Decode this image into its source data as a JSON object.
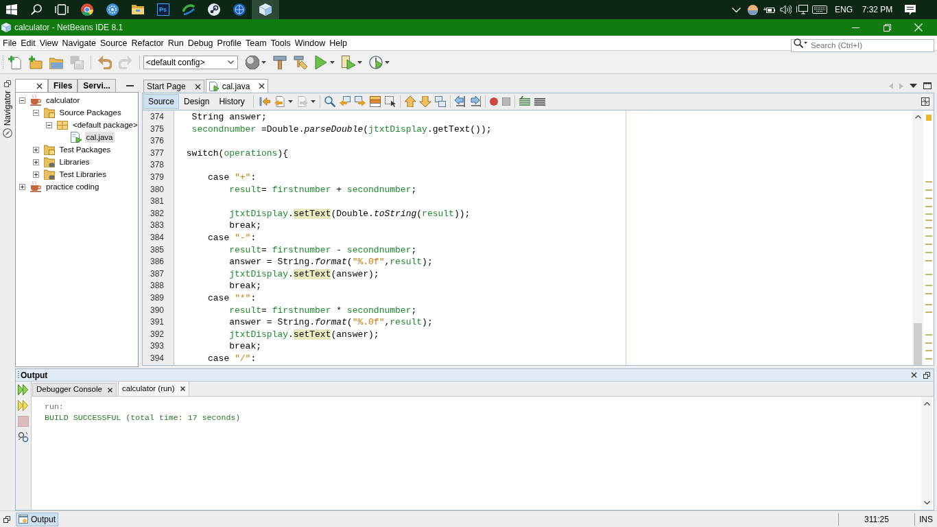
{
  "taskbar": {
    "apps": [
      {
        "selected": false
      },
      {
        "selected": false
      },
      {
        "selected": false
      },
      {
        "selected": false,
        "label": "Ps"
      },
      {
        "selected": false
      },
      {
        "selected": false
      },
      {
        "selected": false
      },
      {
        "selected": true
      }
    ],
    "tray": {
      "language": "ENG",
      "time": "7:32 PM"
    }
  },
  "window": {
    "title": "calculator - NetBeans IDE 8.1"
  },
  "menu": [
    "File",
    "Edit",
    "View",
    "Navigate",
    "Source",
    "Refactor",
    "Run",
    "Debug",
    "Profile",
    "Team",
    "Tools",
    "Window",
    "Help"
  ],
  "search": {
    "placeholder": "Search (Ctrl+I)"
  },
  "toolbar": {
    "file_buttons": [
      {
        "disabled": false
      },
      {
        "disabled": false
      },
      {
        "disabled": false
      },
      {
        "disabled": true
      }
    ],
    "edit_buttons": [
      {
        "disabled": false
      },
      {
        "disabled": true
      }
    ],
    "config": "<default config>",
    "run_buttons": [
      {
        "dropdown": true
      },
      {
        "dropdown": false
      },
      {
        "dropdown": false
      },
      {
        "dropdown": true
      },
      {
        "dropdown": true
      },
      {
        "dropdown": true
      }
    ]
  },
  "side_strip": {
    "label": "Navigator"
  },
  "projects": {
    "tabs": [
      {
        "selected": true,
        "closable": true
      },
      {
        "label": "Files",
        "selected": false,
        "closable": false
      },
      {
        "label": "Servi...",
        "selected": false,
        "closable": false
      }
    ],
    "tree": [
      {
        "label": "calculator",
        "kind": "project",
        "expanded": true,
        "selected": false,
        "children": [
          {
            "label": "Source Packages",
            "kind": "source_folder",
            "expanded": true,
            "selected": false,
            "children": [
              {
                "label": "<default package>",
                "kind": "package",
                "expanded": true,
                "selected": false,
                "children": [
                  {
                    "label": "cal.java",
                    "kind": "java_file",
                    "selected": true
                  }
                ]
              }
            ]
          },
          {
            "label": "Test Packages",
            "kind": "source_folder",
            "expanded": false,
            "selected": false
          },
          {
            "label": "Libraries",
            "kind": "library_folder",
            "expanded": false,
            "selected": false
          },
          {
            "label": "Test Libraries",
            "kind": "library_folder",
            "expanded": false,
            "selected": false
          }
        ]
      },
      {
        "label": "practice coding",
        "kind": "project",
        "expanded": false,
        "selected": false
      }
    ]
  },
  "editor": {
    "tabs": [
      {
        "label": "Start Page",
        "selected": false
      },
      {
        "label": "cal.java",
        "selected": true
      }
    ],
    "views": [
      {
        "label": "Source",
        "selected": true
      },
      {
        "label": "Design",
        "selected": false
      },
      {
        "label": "History",
        "selected": false
      }
    ],
    "toolbar": [
      {
        "disabled": false,
        "dropdown": false
      },
      {
        "disabled": false,
        "dropdown": true
      },
      {
        "disabled": true,
        "dropdown": true
      },
      {
        "disabled": false,
        "dropdown": false
      },
      {
        "disabled": false,
        "dropdown": false
      },
      {
        "disabled": false,
        "dropdown": false
      },
      {
        "disabled": false,
        "dropdown": false
      },
      {
        "disabled": false,
        "dropdown": false
      },
      {
        "disabled": false,
        "dropdown": false
      },
      {
        "disabled": false,
        "dropdown": false
      },
      {
        "disabled": false,
        "dropdown": false
      },
      {
        "disabled": false,
        "dropdown": false
      },
      {
        "disabled": false,
        "dropdown": false
      },
      {
        "disabled": false,
        "dropdown": false
      },
      {
        "disabled": false,
        "dropdown": false
      },
      {
        "disabled": false,
        "dropdown": false
      },
      {
        "disabled": false,
        "dropdown": false
      }
    ],
    "lines": [
      {
        "number": "374",
        "tokens": [
          {
            "text": "  String answer;",
            "kind": "plain"
          }
        ]
      },
      {
        "number": "375",
        "tokens": [
          {
            "text": "  secondnumber",
            "kind": "field"
          },
          {
            "text": " =Double.",
            "kind": "plain"
          },
          {
            "text": "parseDouble",
            "kind": "method"
          },
          {
            "text": "(",
            "kind": "plain"
          },
          {
            "text": "jtxtDisplay",
            "kind": "field"
          },
          {
            "text": ".getText());",
            "kind": "plain"
          }
        ]
      },
      {
        "number": "376"
      },
      {
        "number": "377",
        "tokens": [
          {
            "text": " switch(",
            "kind": "plain"
          },
          {
            "text": "operations",
            "kind": "field"
          },
          {
            "text": "){",
            "kind": "plain"
          }
        ]
      },
      {
        "number": "378"
      },
      {
        "number": "379",
        "tokens": [
          {
            "text": "     case ",
            "kind": "plain"
          },
          {
            "text": "\"+\"",
            "kind": "string"
          },
          {
            "text": ":",
            "kind": "plain"
          }
        ]
      },
      {
        "number": "380",
        "tokens": [
          {
            "text": "         result",
            "kind": "field"
          },
          {
            "text": "= ",
            "kind": "plain"
          },
          {
            "text": "firstnumber",
            "kind": "field"
          },
          {
            "text": " + ",
            "kind": "plain"
          },
          {
            "text": "secondnumber",
            "kind": "field"
          },
          {
            "text": ";",
            "kind": "plain"
          }
        ]
      },
      {
        "number": "381"
      },
      {
        "number": "382",
        "tokens": [
          {
            "text": "         jtxtDisplay",
            "kind": "field"
          },
          {
            "text": ".",
            "kind": "plain"
          },
          {
            "text": "setText",
            "kind": "occurrence"
          },
          {
            "text": "(Double.",
            "kind": "plain"
          },
          {
            "text": "toString",
            "kind": "method"
          },
          {
            "text": "(",
            "kind": "plain"
          },
          {
            "text": "result",
            "kind": "field"
          },
          {
            "text": "));",
            "kind": "plain"
          }
        ]
      },
      {
        "number": "383",
        "tokens": [
          {
            "text": "         break;",
            "kind": "plain"
          }
        ]
      },
      {
        "number": "384",
        "tokens": [
          {
            "text": "     case ",
            "kind": "plain"
          },
          {
            "text": "\"-\"",
            "kind": "string"
          },
          {
            "text": ":",
            "kind": "plain"
          }
        ]
      },
      {
        "number": "385",
        "tokens": [
          {
            "text": "         result",
            "kind": "field"
          },
          {
            "text": "= ",
            "kind": "plain"
          },
          {
            "text": "firstnumber",
            "kind": "field"
          },
          {
            "text": " - ",
            "kind": "plain"
          },
          {
            "text": "secondnumber",
            "kind": "field"
          },
          {
            "text": ";",
            "kind": "plain"
          }
        ]
      },
      {
        "number": "386",
        "tokens": [
          {
            "text": "         answer = String.",
            "kind": "plain"
          },
          {
            "text": "format",
            "kind": "method"
          },
          {
            "text": "(",
            "kind": "plain"
          },
          {
            "text": "\"%.0f\"",
            "kind": "string"
          },
          {
            "text": ",",
            "kind": "plain"
          },
          {
            "text": "result",
            "kind": "field"
          },
          {
            "text": ");",
            "kind": "plain"
          }
        ]
      },
      {
        "number": "387",
        "tokens": [
          {
            "text": "         jtxtDisplay",
            "kind": "field"
          },
          {
            "text": ".",
            "kind": "plain"
          },
          {
            "text": "setText",
            "kind": "occurrence"
          },
          {
            "text": "(answer);",
            "kind": "plain"
          }
        ]
      },
      {
        "number": "388",
        "tokens": [
          {
            "text": "         break;",
            "kind": "plain"
          }
        ]
      },
      {
        "number": "389",
        "tokens": [
          {
            "text": "     case ",
            "kind": "plain"
          },
          {
            "text": "\"*\"",
            "kind": "string"
          },
          {
            "text": ":",
            "kind": "plain"
          }
        ]
      },
      {
        "number": "390",
        "tokens": [
          {
            "text": "         result",
            "kind": "field"
          },
          {
            "text": "= ",
            "kind": "plain"
          },
          {
            "text": "firstnumber",
            "kind": "field"
          },
          {
            "text": " * ",
            "kind": "plain"
          },
          {
            "text": "secondnumber",
            "kind": "field"
          },
          {
            "text": ";",
            "kind": "plain"
          }
        ]
      },
      {
        "number": "391",
        "tokens": [
          {
            "text": "         answer = String.",
            "kind": "plain"
          },
          {
            "text": "format",
            "kind": "method"
          },
          {
            "text": "(",
            "kind": "plain"
          },
          {
            "text": "\"%.0f\"",
            "kind": "string"
          },
          {
            "text": ",",
            "kind": "plain"
          },
          {
            "text": "result",
            "kind": "field"
          },
          {
            "text": ");",
            "kind": "plain"
          }
        ]
      },
      {
        "number": "392",
        "tokens": [
          {
            "text": "         jtxtDisplay",
            "kind": "field"
          },
          {
            "text": ".",
            "kind": "plain"
          },
          {
            "text": "setText",
            "kind": "occurrence"
          },
          {
            "text": "(answer);",
            "kind": "plain"
          }
        ]
      },
      {
        "number": "393",
        "tokens": [
          {
            "text": "         break;",
            "kind": "plain"
          }
        ]
      },
      {
        "number": "394",
        "tokens": [
          {
            "text": "     case ",
            "kind": "plain"
          },
          {
            "text": "\"/\"",
            "kind": "string"
          },
          {
            "text": ":",
            "kind": "plain"
          }
        ]
      }
    ]
  },
  "output": {
    "title": "Output",
    "actions": [
      {
        "disabled": false
      },
      {
        "disabled": false
      },
      {
        "disabled": true
      },
      {
        "disabled": false
      }
    ],
    "tabs": [
      {
        "label": "Debugger Console",
        "selected": false
      },
      {
        "label": "calculator (run)",
        "selected": true
      }
    ],
    "lines": [
      {
        "text": "run:",
        "kind": "info"
      },
      {
        "text": "BUILD SUCCESSFUL (total time: 17 seconds)",
        "kind": "success"
      }
    ]
  },
  "status_bar": {
    "windows": [
      {
        "label": "Output",
        "selected": true
      }
    ],
    "position": "311:25",
    "mode": "INS"
  }
}
